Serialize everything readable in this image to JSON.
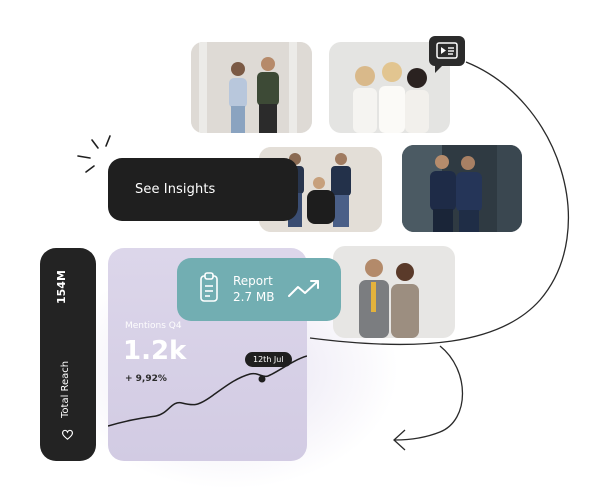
{
  "insights": {
    "label": "See Insights"
  },
  "reach": {
    "value": "154M",
    "label": "Total Reach",
    "icon": "heart-icon"
  },
  "chart": {
    "caption": "Mentions Q4",
    "value": "1.2k",
    "change": "+ 9,92%",
    "tooltip": "12th Jul"
  },
  "report": {
    "title": "Report",
    "size": "2.7 MB",
    "icon": "clipboard-icon",
    "trend_icon": "trend-up-icon"
  },
  "video_chip": {
    "icon": "video-icon"
  },
  "colors": {
    "dark": "#1f1f1f",
    "teal": "#72aeb2",
    "lavender": "#d8d2e8"
  }
}
